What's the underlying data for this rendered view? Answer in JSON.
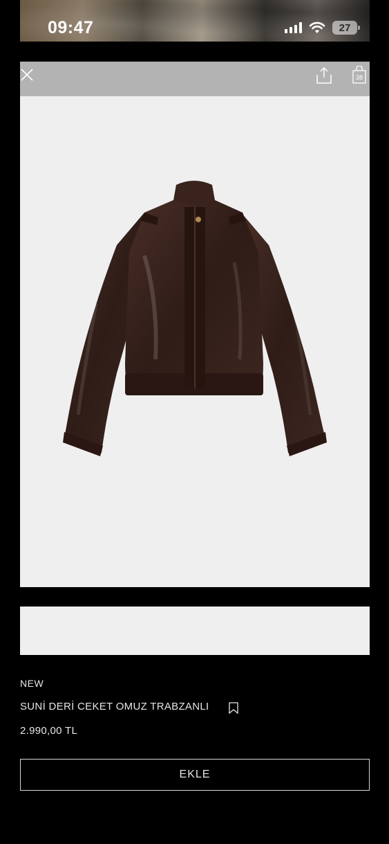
{
  "status_bar": {
    "time": "09:47",
    "battery": "27"
  },
  "toolbar": {
    "close_icon": "close-icon",
    "share_icon": "share-icon",
    "bag_icon": "shopping-bag-icon",
    "bag_count": "38"
  },
  "product": {
    "image_desc_icon": "jacket-image",
    "tag": "NEW",
    "name": "SUNİ DERİ CEKET OMUZ TRABZANLI",
    "price": "2.990,00 TL",
    "add_label": "EKLE"
  },
  "colors": {
    "background": "#000000",
    "toolbar": "#b3b3b3",
    "image_bg": "#efefef",
    "jacket": "#3a2520"
  }
}
